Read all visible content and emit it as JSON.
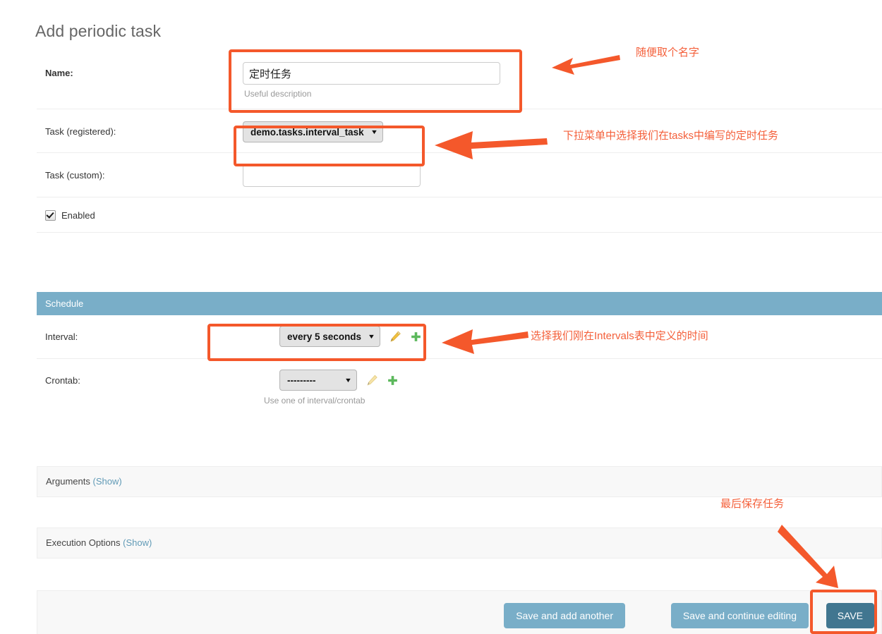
{
  "page": {
    "title": "Add periodic task"
  },
  "form": {
    "rows": [
      {
        "label": "Name:",
        "value": "定时任务",
        "help": "Useful description"
      },
      {
        "label": "Task (registered):",
        "value": "demo.tasks.interval_task"
      },
      {
        "label": "Task (custom):",
        "value": ""
      },
      {
        "label": "Enabled"
      }
    ],
    "name_label": "Name:",
    "name_value": "定时任务",
    "name_help": "Useful description",
    "task_registered_label": "Task (registered):",
    "task_registered_value": "demo.tasks.interval_task",
    "task_custom_label": "Task (custom):",
    "task_custom_value": "",
    "enabled_label": "Enabled",
    "enabled_checked": "true"
  },
  "schedule": {
    "header": "Schedule",
    "interval_label": "Interval:",
    "interval_value": "every 5 seconds",
    "crontab_label": "Crontab:",
    "crontab_value": "---------",
    "crontab_help": "Use one of interval/crontab",
    "edit_icon": "pencil-icon",
    "add_icon": "plus-icon"
  },
  "panels": {
    "arguments_label": "Arguments",
    "arguments_toggle": "(Show)",
    "execution_label": "Execution Options",
    "execution_toggle": "(Show)"
  },
  "submit": {
    "save_and_add_another": "Save and add another",
    "save_and_continue": "Save and continue editing",
    "save": "SAVE"
  },
  "annotations": {
    "name_note": "随便取个名字",
    "task_note": "下拉菜单中选择我们在tasks中编写的定时任务",
    "interval_note": "选择我们刚在Intervals表中定义的时间",
    "save_note": "最后保存任务",
    "color": "#f4582b"
  },
  "colors": {
    "accent_blue": "#79aec8",
    "save_blue": "#417690",
    "link_blue": "#609ab6",
    "annotation_orange": "#f4582b",
    "title_gray": "#666666"
  }
}
